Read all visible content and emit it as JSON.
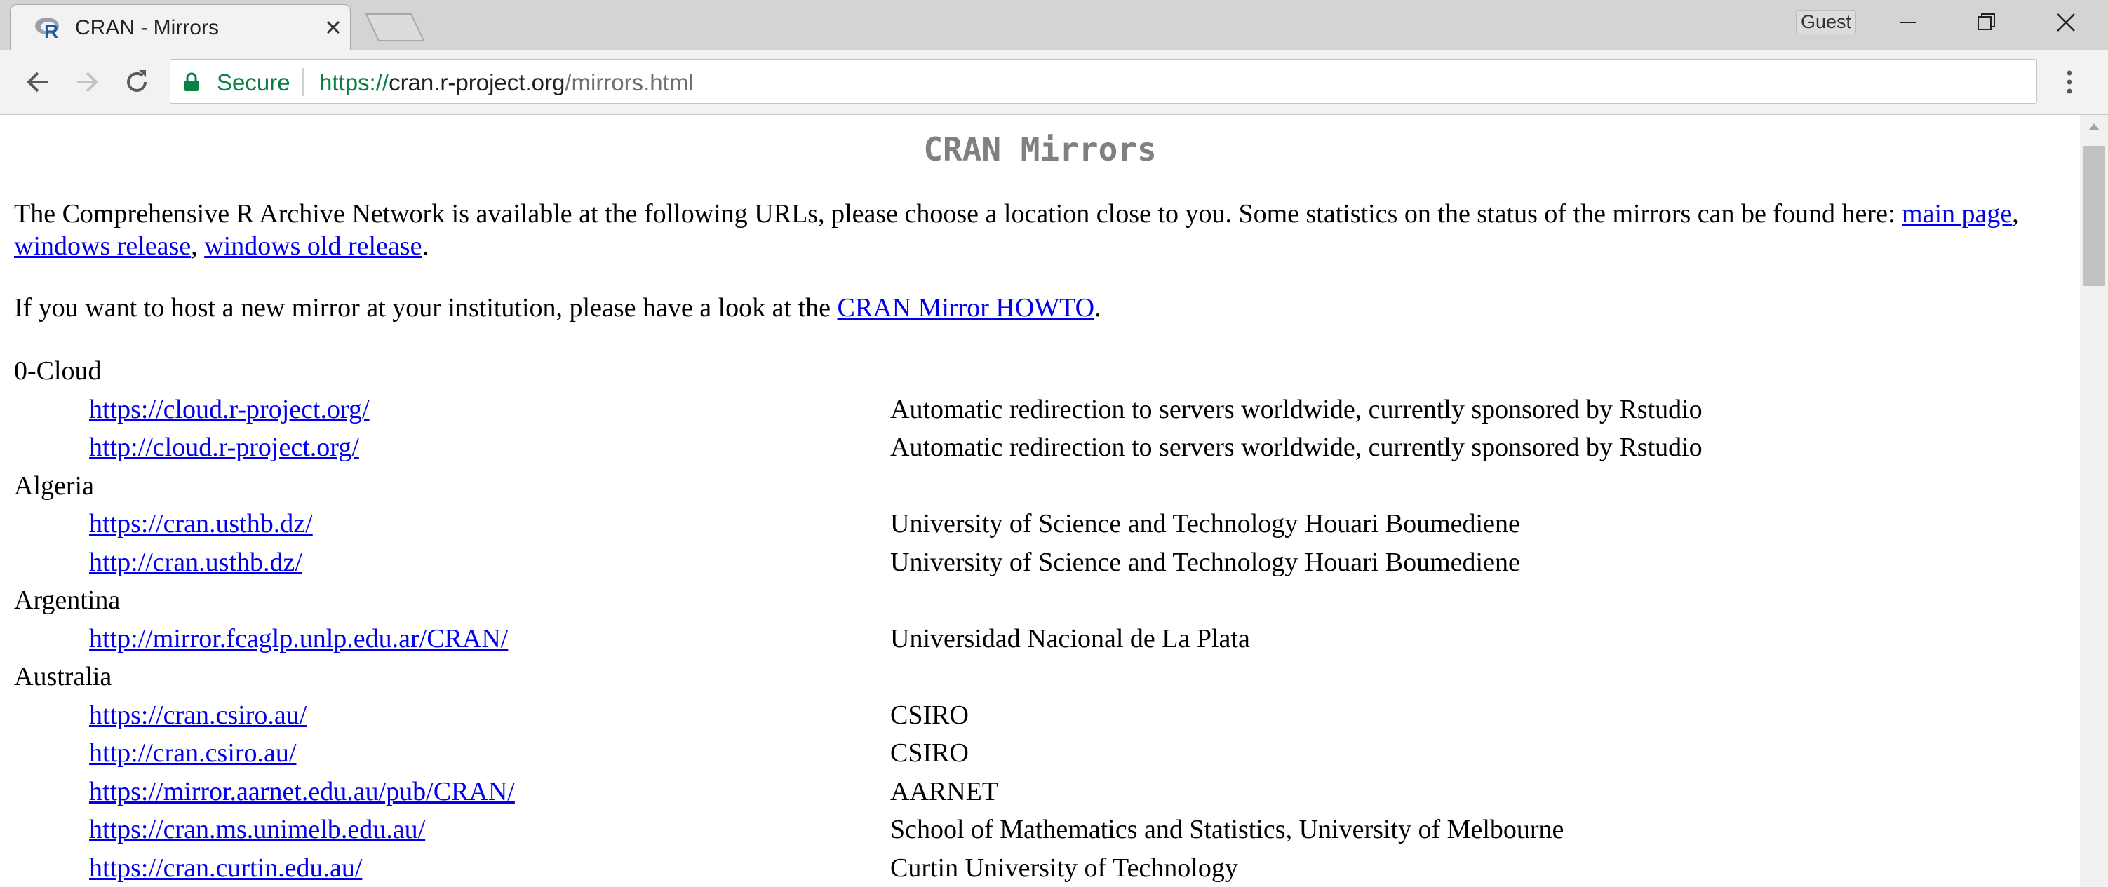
{
  "browser": {
    "tab_title": "CRAN - Mirrors",
    "profile_label": "Guest",
    "secure_label": "Secure",
    "url_scheme": "https://",
    "url_host": "cran.r-project.org",
    "url_path": "/mirrors.html",
    "accent_secure": "#0b8043"
  },
  "page": {
    "title": "CRAN Mirrors",
    "intro_text": "The Comprehensive R Archive Network is available at the following URLs, please choose a location close to you. Some statistics on the status of the mirrors can be found here: ",
    "intro_link_main": "main page",
    "intro_sep_1": ", ",
    "intro_link_windows": "windows release",
    "intro_sep_2": ", ",
    "intro_link_windows_old": "windows old release",
    "intro_end": ".",
    "howto_text": "If you want to host a new mirror at your institution, please have a look at the ",
    "howto_link": "CRAN Mirror HOWTO",
    "howto_end": "."
  },
  "mirrors": [
    {
      "country": "0-Cloud",
      "entries": [
        {
          "url": "https://cloud.r-project.org/",
          "desc": "Automatic redirection to servers worldwide, currently sponsored by Rstudio"
        },
        {
          "url": "http://cloud.r-project.org/",
          "desc": "Automatic redirection to servers worldwide, currently sponsored by Rstudio"
        }
      ]
    },
    {
      "country": "Algeria",
      "entries": [
        {
          "url": "https://cran.usthb.dz/",
          "desc": "University of Science and Technology Houari Boumediene"
        },
        {
          "url": "http://cran.usthb.dz/",
          "desc": "University of Science and Technology Houari Boumediene"
        }
      ]
    },
    {
      "country": "Argentina",
      "entries": [
        {
          "url": "http://mirror.fcaglp.unlp.edu.ar/CRAN/",
          "desc": "Universidad Nacional de La Plata"
        }
      ]
    },
    {
      "country": "Australia",
      "entries": [
        {
          "url": "https://cran.csiro.au/",
          "desc": "CSIRO"
        },
        {
          "url": "http://cran.csiro.au/",
          "desc": "CSIRO"
        },
        {
          "url": "https://mirror.aarnet.edu.au/pub/CRAN/",
          "desc": "AARNET"
        },
        {
          "url": "https://cran.ms.unimelb.edu.au/",
          "desc": "School of Mathematics and Statistics, University of Melbourne"
        },
        {
          "url": "https://cran.curtin.edu.au/",
          "desc": "Curtin University of Technology"
        }
      ]
    }
  ]
}
